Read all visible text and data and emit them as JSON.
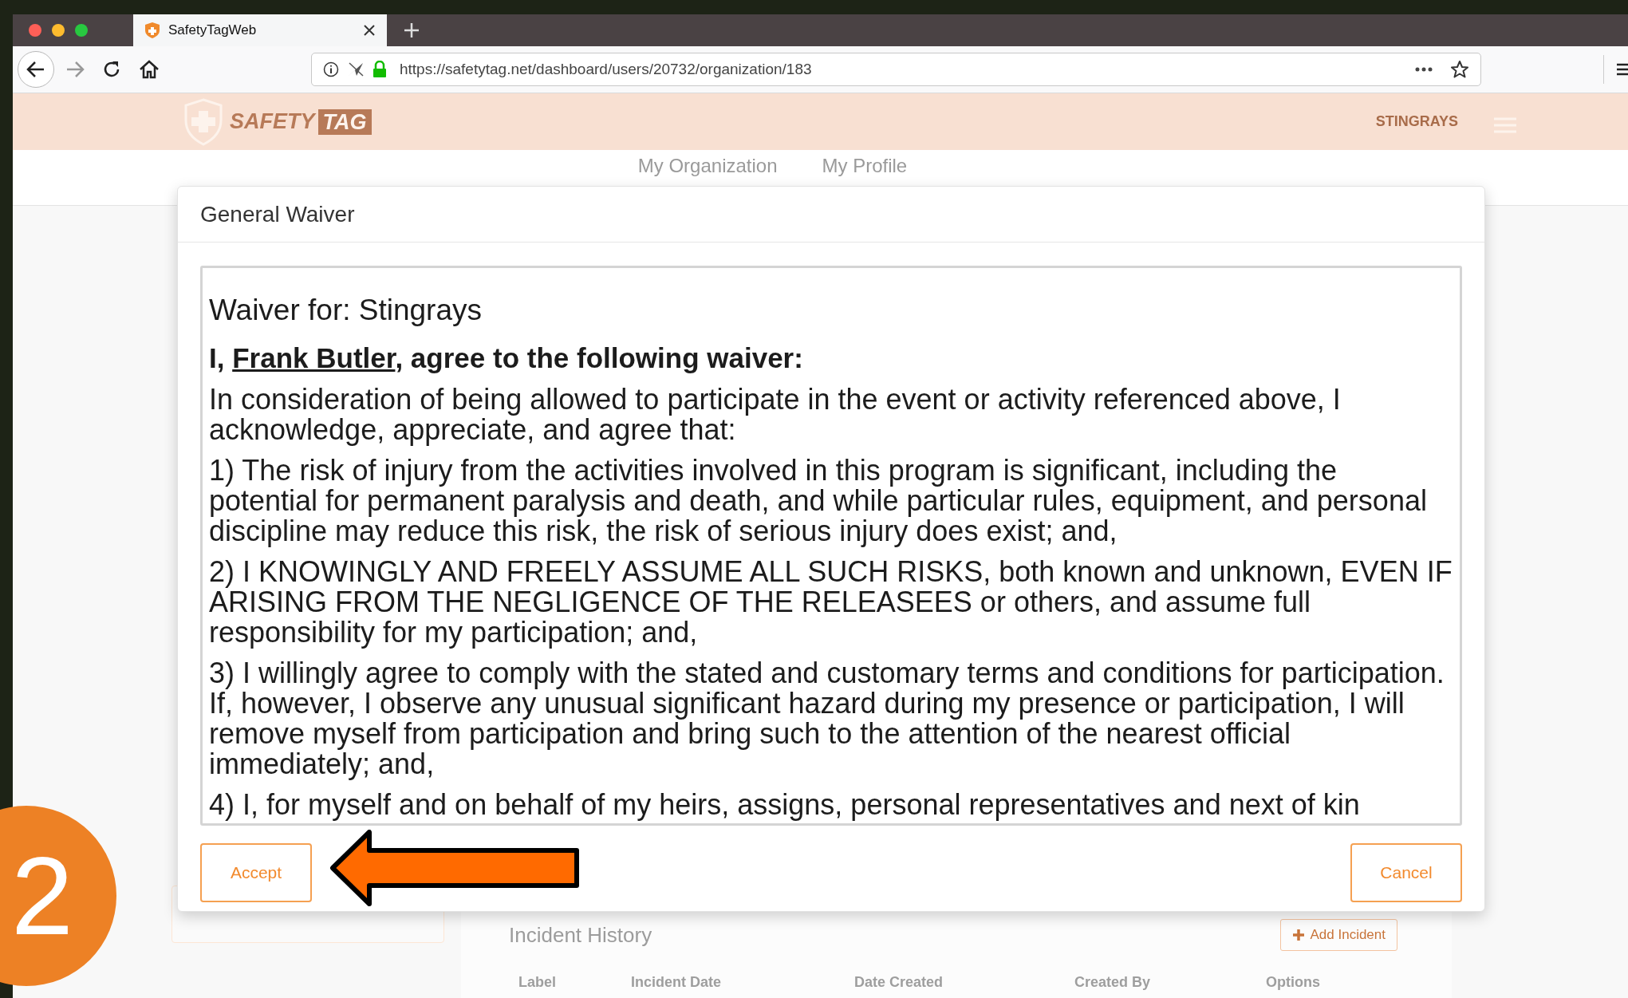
{
  "browser": {
    "tab_title": "SafetyTagWeb",
    "url": "https://safetytag.net/dashboard/users/20732/organization/183"
  },
  "site_header": {
    "logo": {
      "word": "SAFETY",
      "boxed_word": "TAG"
    },
    "organization": "STINGRAYS"
  },
  "nav": [
    "My Organization",
    "My Profile"
  ],
  "background_page": {
    "section_title": "Incident History",
    "add_button": "Add Incident",
    "columns": [
      "Label",
      "Incident Date",
      "Date Created",
      "Created By",
      "Options"
    ]
  },
  "modal": {
    "title": "General Waiver",
    "waiver": {
      "heading": "Waiver for: Stingrays",
      "agreement": {
        "before": "I, ",
        "name": "Frank Butler",
        "after": ", agree to the following waiver:"
      },
      "paragraphs": [
        "In consideration of being allowed to participate in the event or activity referenced above, I acknowledge, appreciate, and agree that:",
        "1) The risk of injury from the activities involved in this program is significant, including the potential for permanent paralysis and death, and while particular rules, equipment, and personal discipline may reduce this risk, the risk of serious injury does exist; and,",
        "2) I KNOWINGLY AND FREELY ASSUME ALL SUCH RISKS, both known and unknown, EVEN IF ARISING FROM THE NEGLIGENCE OF THE RELEASEES or others, and assume full responsibility for my participation; and,",
        "3) I willingly agree to comply with the stated and customary terms and conditions for participation. If, however, I observe any unusual significant hazard during my presence or participation, I will remove myself from participation and bring such to the attention of the nearest official immediately; and,",
        "4) I, for myself and on behalf of my heirs, assigns, personal representatives and next of kin"
      ]
    },
    "buttons": {
      "accept": "Accept",
      "cancel": "Cancel"
    }
  },
  "annotation": {
    "step": "2"
  }
}
